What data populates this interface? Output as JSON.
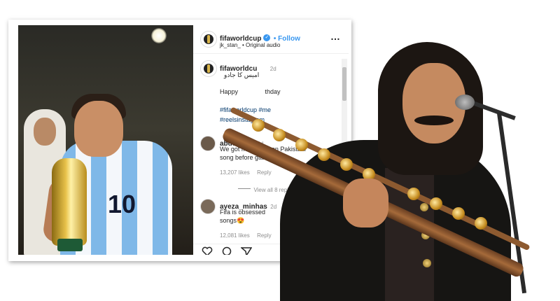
{
  "post": {
    "username": "fifaworldcup",
    "follow_label": "• Follow",
    "audio_line": "jk_stan_ • Original audio",
    "more_icon": "…",
    "caption_username": "fifaworldcu",
    "caption_time": "2d",
    "caption_urdu": "امیس کا جادو",
    "caption_birthday": "Happy",
    "caption_birthday2": "thday",
    "hashtags": "#fifaworldcup #me",
    "hashtags2": "#reelsinstagram"
  },
  "comments": [
    {
      "username": "abdullax.4",
      "time": "2d",
      "text_line1": "We got messi edit on Pakistani",
      "text_line2": "song before gta6😂",
      "likes": "13,207 likes",
      "reply": "Reply"
    },
    {
      "username": "ayeza_minhas",
      "time": "2d",
      "text_line1": "Fifa is obsessed",
      "text_line2": "songs😍",
      "likes": "12,081 likes",
      "reply": "Reply"
    }
  ],
  "view_replies": "View all 8 replies",
  "photo": {
    "jersey_number": "10"
  },
  "colors": {
    "accent_blue": "#3897f0",
    "text_dark": "#262626",
    "muted": "#8e8e8e"
  }
}
